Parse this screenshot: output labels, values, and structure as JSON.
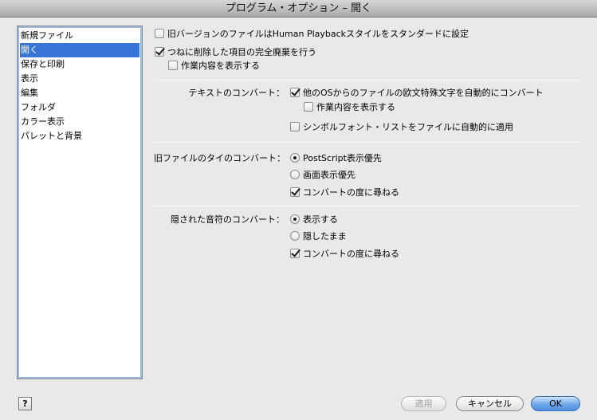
{
  "window": {
    "title": "プログラム・オプション – 開く"
  },
  "sidebar": {
    "items": [
      {
        "label": "新規ファイル",
        "selected": false
      },
      {
        "label": "開く",
        "selected": true
      },
      {
        "label": "保存と印刷",
        "selected": false
      },
      {
        "label": "表示",
        "selected": false
      },
      {
        "label": "編集",
        "selected": false
      },
      {
        "label": "フォルダ",
        "selected": false
      },
      {
        "label": "カラー表示",
        "selected": false
      },
      {
        "label": "パレットと背景",
        "selected": false
      }
    ]
  },
  "general": {
    "old_version_playback": {
      "label": "旧バージョンのファイルはHuman Playbackスタイルをスタンダードに設定",
      "checked": false
    },
    "always_purge": {
      "label": "つねに削除した項目の完全廃棄を行う",
      "checked": true
    },
    "show_progress": {
      "label": "作業内容を表示する",
      "checked": false
    }
  },
  "text_convert": {
    "section_label": "テキストのコンバート：",
    "auto_convert": {
      "label": "他のOSからのファイルの欧文特殊文字を自動的にコンバート",
      "checked": true
    },
    "show_progress": {
      "label": "作業内容を表示する",
      "checked": false
    },
    "symbol_font": {
      "label": "シンボルフォント・リストをファイルに自動的に適用",
      "checked": false
    }
  },
  "tie_convert": {
    "section_label": "旧ファイルのタイのコンバート：",
    "options": [
      {
        "label": "PostScript表示優先",
        "selected": true
      },
      {
        "label": "画面表示優先",
        "selected": false
      }
    ],
    "ask": {
      "label": "コンバートの度に尋ねる",
      "checked": true
    }
  },
  "hidden_notes": {
    "section_label": "隠された音符のコンバート：",
    "options": [
      {
        "label": "表示する",
        "selected": true
      },
      {
        "label": "隠したまま",
        "selected": false
      }
    ],
    "ask": {
      "label": "コンバートの度に尋ねる",
      "checked": true
    }
  },
  "footer": {
    "help_label": "?",
    "apply_label": "適用",
    "cancel_label": "キャンセル",
    "ok_label": "OK"
  }
}
